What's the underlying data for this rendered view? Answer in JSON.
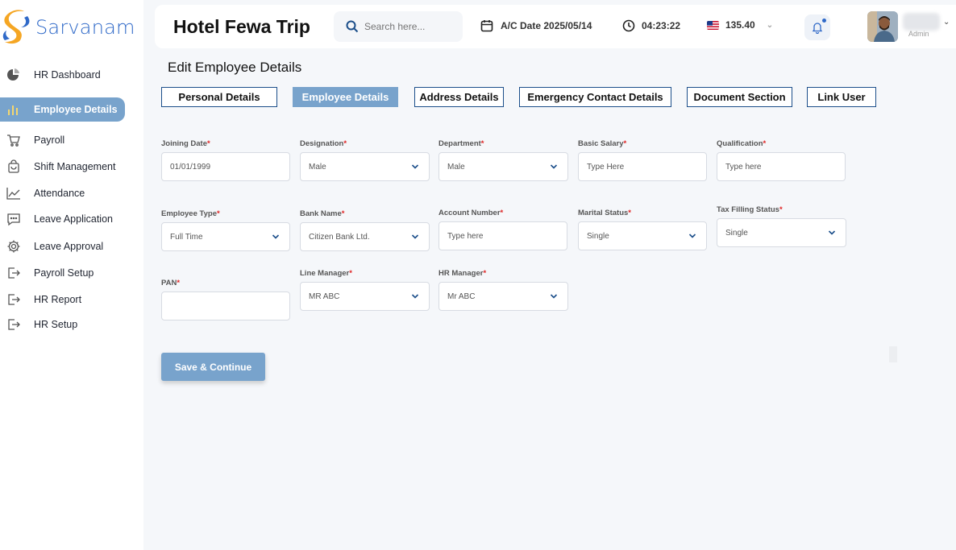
{
  "brand": {
    "name": "Sarvanam"
  },
  "sidebar": {
    "items": [
      {
        "label": "HR Dashboard",
        "icon": "pie-chart-icon",
        "active": false
      },
      {
        "label": "Employee Details",
        "icon": "bar-chart-icon",
        "active": true
      },
      {
        "label": "Payroll",
        "icon": "cart-icon",
        "active": false
      },
      {
        "label": "Shift Management",
        "icon": "shopping-bag-icon",
        "active": false
      },
      {
        "label": "Attendance",
        "icon": "line-chart-icon",
        "active": false
      },
      {
        "label": "Leave Application",
        "icon": "chat-icon",
        "active": false
      },
      {
        "label": "Leave Approval",
        "icon": "gear-icon",
        "active": false
      },
      {
        "label": "Payroll Setup",
        "icon": "logout-icon",
        "active": false
      },
      {
        "label": "HR Report",
        "icon": "logout-icon",
        "active": false
      },
      {
        "label": "HR Setup",
        "icon": "logout-icon",
        "active": false
      }
    ]
  },
  "header": {
    "title": "Hotel Fewa Trip",
    "search_placeholder": "Search here...",
    "date": "A/C Date 2025/05/14",
    "time": "04:23:22",
    "currency_value": "135.40",
    "user_role": "Admin"
  },
  "main": {
    "page_title": "Edit Employee Details",
    "tabs": [
      {
        "label": "Personal Details",
        "active": false
      },
      {
        "label": "Employee Details",
        "active": true
      },
      {
        "label": "Address Details",
        "active": false
      },
      {
        "label": "Emergency Contact Details",
        "active": false
      },
      {
        "label": "Document Section",
        "active": false
      },
      {
        "label": "Link User",
        "active": false
      }
    ],
    "fields": {
      "joining_date": {
        "label": "Joining Date",
        "value": "01/01/1999"
      },
      "designation": {
        "label": "Designation",
        "value": "Male"
      },
      "department": {
        "label": "Department",
        "value": "Male"
      },
      "basic_salary": {
        "label": "Basic Salary",
        "placeholder": "Type Here"
      },
      "qualification": {
        "label": "Qualification",
        "placeholder": "Type here"
      },
      "employee_type": {
        "label": "Employee Type",
        "value": "Full Time"
      },
      "bank_name": {
        "label": "Bank Name",
        "value": "Citizen Bank Ltd."
      },
      "account_number": {
        "label": "Account Number",
        "placeholder": "Type here"
      },
      "marital_status": {
        "label": "Marital Status",
        "value": "Single"
      },
      "tax_filling_status": {
        "label": "Tax Filling Status",
        "value": "Single"
      },
      "pan": {
        "label": "PAN",
        "value": ""
      },
      "line_manager": {
        "label": "Line Manager",
        "value": "MR ABC"
      },
      "hr_manager": {
        "label": "HR Manager",
        "value": "Mr ABC"
      }
    },
    "required_mark": "*",
    "save_label": "Save & Continue"
  },
  "colors": {
    "accent": "#78a3cc",
    "brand_blue": "#2f69c8",
    "brand_orange": "#f5a623",
    "required": "#e02424",
    "tab_border": "#1b4e8a"
  }
}
